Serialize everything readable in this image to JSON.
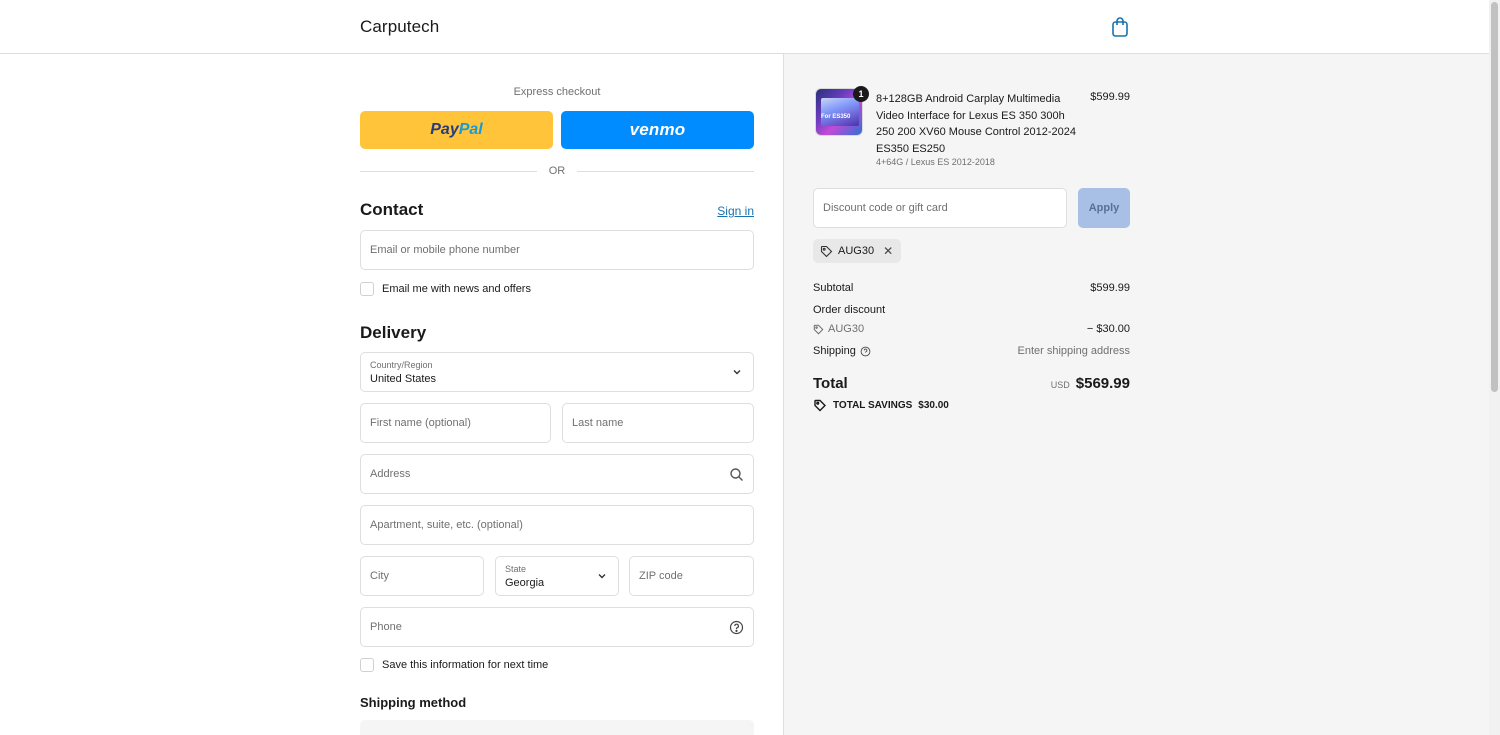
{
  "header": {
    "brand": "Carputech",
    "cart_icon": "shopping-bag-icon"
  },
  "express": {
    "label": "Express checkout",
    "paypal_part1": "Pay",
    "paypal_part2": "Pal",
    "venmo_label": "venmo",
    "or_label": "OR"
  },
  "contact": {
    "title": "Contact",
    "signin_label": "Sign in",
    "email_placeholder": "Email or mobile phone number",
    "newsletter_label": "Email me with news and offers"
  },
  "delivery": {
    "title": "Delivery",
    "country_label": "Country/Region",
    "country_value": "United States",
    "first_name_placeholder": "First name (optional)",
    "last_name_placeholder": "Last name",
    "address_placeholder": "Address",
    "apartment_placeholder": "Apartment, suite, etc. (optional)",
    "city_placeholder": "City",
    "state_label": "State",
    "state_value": "Georgia",
    "zip_placeholder": "ZIP code",
    "phone_placeholder": "Phone",
    "save_info_label": "Save this information for next time"
  },
  "shipping_method": {
    "title": "Shipping method"
  },
  "summary": {
    "item": {
      "quantity": "1",
      "name": "8+128GB Android Carplay Multimedia Video Interface for Lexus ES 350 300h 250 200 XV60 Mouse Control 2012-2024 ES350 ES250",
      "variant": "4+64G / Lexus ES 2012-2018",
      "price": "$599.99",
      "thumb_text": "For ES350"
    },
    "discount_placeholder": "Discount code or gift card",
    "apply_label": "Apply",
    "applied_code": "AUG30",
    "subtotal_label": "Subtotal",
    "subtotal_value": "$599.99",
    "order_discount_label": "Order discount",
    "order_discount_code": "AUG30",
    "order_discount_value": "− $30.00",
    "shipping_label": "Shipping",
    "shipping_value": "Enter shipping address",
    "total_label": "Total",
    "total_currency": "USD",
    "total_value": "$569.99",
    "savings_label": "TOTAL SAVINGS",
    "savings_value": "$30.00"
  },
  "colors": {
    "paypal": "#ffc439",
    "venmo": "#008cff",
    "link": "#1773b0",
    "apply_disabled": "#a8c0e6"
  }
}
